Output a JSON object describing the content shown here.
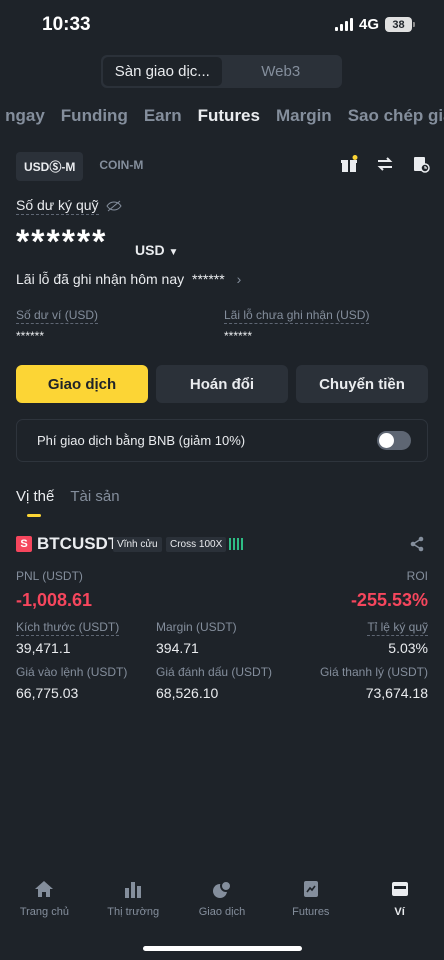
{
  "status": {
    "time": "10:33",
    "network": "4G",
    "battery": "38"
  },
  "segment": [
    "Sàn giao dịc...",
    "Web3"
  ],
  "tabs": [
    "o ngay",
    "Funding",
    "Earn",
    "Futures",
    "Margin",
    "Sao chép giao"
  ],
  "subtabs": [
    "USDⓈ-M",
    "COIN-M"
  ],
  "balance": {
    "label": "Số dư ký quỹ",
    "value": "******",
    "currency": "USD",
    "pnl_today_label": "Lãi lỗ đã ghi nhận hôm nay",
    "pnl_today_value": "******",
    "wallet_label": "Số dư ví (USD)",
    "wallet_value": "******",
    "unrealized_label": "Lãi lỗ chưa ghi nhận (USD)",
    "unrealized_value": "******"
  },
  "actions": [
    "Giao dịch",
    "Hoán đổi",
    "Chuyển tiền"
  ],
  "bnb_fee": {
    "label": "Phí giao dịch bằng BNB (giảm 10%)",
    "enabled": false
  },
  "position_tabs": [
    "Vị thế",
    "Tài sản"
  ],
  "position": {
    "side_badge": "S",
    "symbol": "BTCUSDT",
    "type": "Vĩnh cửu",
    "margin_mode": "Cross 100X",
    "pnl_label": "PNL (USDT)",
    "pnl_value": "-1,008.61",
    "roi_label": "ROI",
    "roi_value": "-255.53%",
    "size_label": "Kích thước (USDT)",
    "size_value": "39,471.1",
    "margin_label": "Margin (USDT)",
    "margin_value": "394.71",
    "margin_ratio_label": "Tỉ lệ ký quỹ",
    "margin_ratio_value": "5.03%",
    "entry_label": "Giá vào lệnh (USDT)",
    "entry_value": "66,775.03",
    "mark_label": "Giá đánh dấu (USDT)",
    "mark_value": "68,526.10",
    "liq_label": "Giá thanh lý (USDT)",
    "liq_value": "73,674.18"
  },
  "bottom_nav": [
    "Trang chủ",
    "Thị trường",
    "Giao dịch",
    "Futures",
    "Ví"
  ],
  "colors": {
    "accent": "#fcd535",
    "loss": "#f6465d",
    "gain": "#2ebd85",
    "bg": "#1e2329"
  }
}
